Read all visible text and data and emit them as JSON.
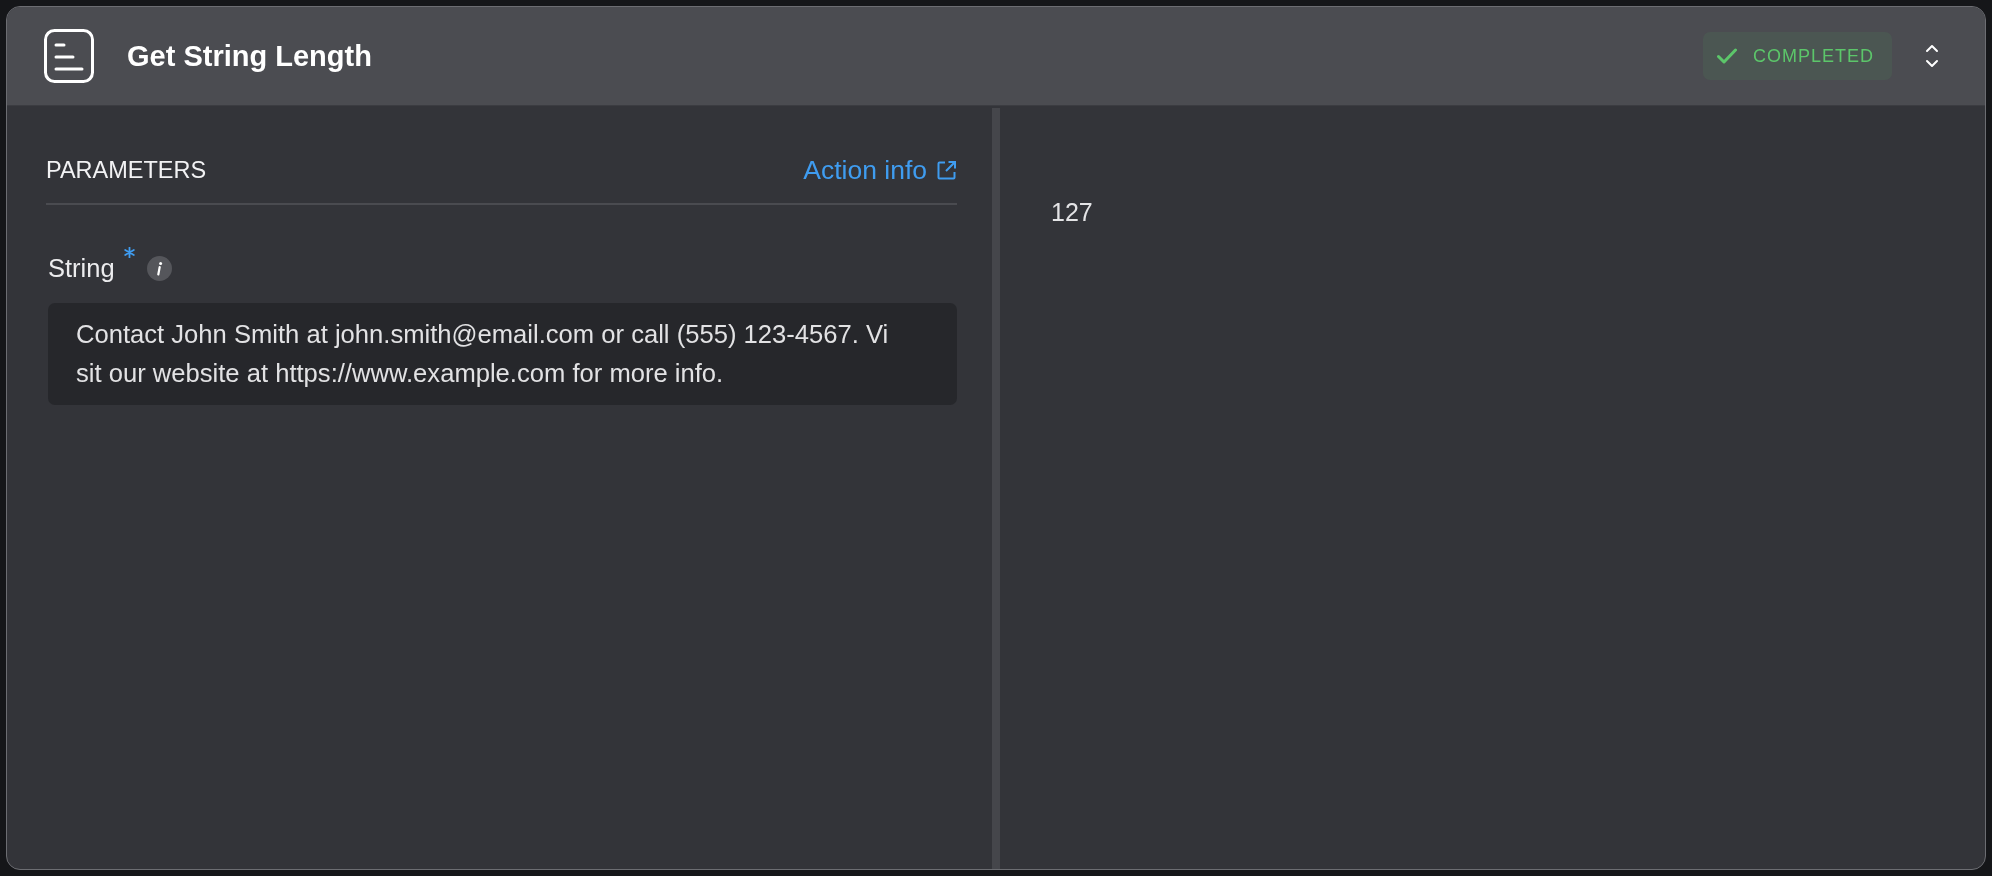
{
  "header": {
    "title": "Get String Length",
    "status": {
      "label": "COMPLETED",
      "kind": "completed"
    }
  },
  "parameters": {
    "heading": "PARAMETERS",
    "action_link": "Action info",
    "fields": [
      {
        "label": "String",
        "required": true,
        "value": "Contact John Smith at john.smith@email.com or call (555) 123-4567. Visit our website at https://www.example.com for more info."
      }
    ]
  },
  "output": {
    "value": "127"
  }
}
